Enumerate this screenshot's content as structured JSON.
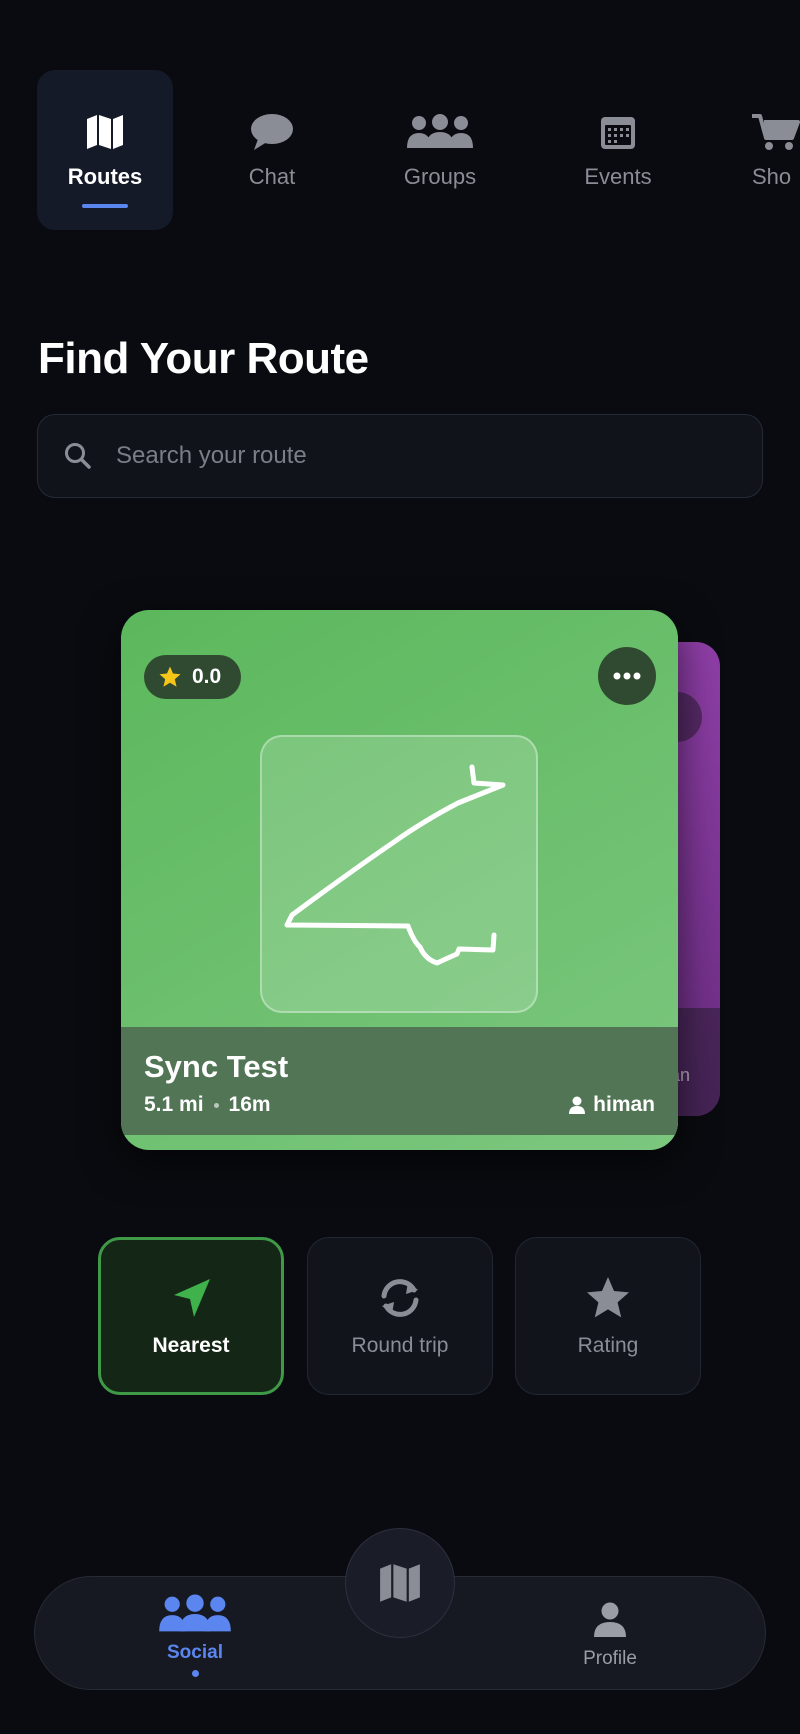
{
  "tabs": [
    {
      "label": "Routes",
      "icon": "map-icon",
      "active": true
    },
    {
      "label": "Chat",
      "icon": "chat-bubble-icon",
      "active": false
    },
    {
      "label": "Groups",
      "icon": "groups-icon",
      "active": false
    },
    {
      "label": "Events",
      "icon": "calendar-icon",
      "active": false
    },
    {
      "label": "Sho",
      "icon": "cart-icon",
      "active": false
    }
  ],
  "page": {
    "title": "Find Your Route"
  },
  "search": {
    "placeholder": "Search your route",
    "value": ""
  },
  "card": {
    "rating": "0.0",
    "name": "Sync Test",
    "distance": "5.1 mi",
    "duration": "16m",
    "author": "himan",
    "color": "#5cb85c"
  },
  "back_card": {
    "author_fragment": "an",
    "color": "#8e3ea6"
  },
  "filters": [
    {
      "label": "Nearest",
      "icon": "navigation-arrow-icon",
      "active": true
    },
    {
      "label": "Round trip",
      "icon": "round-trip-icon",
      "active": false
    },
    {
      "label": "Rating",
      "icon": "star-icon",
      "active": false
    }
  ],
  "bottom_nav": {
    "social": "Social",
    "profile": "Profile",
    "center_icon": "map-icon"
  },
  "colors": {
    "accent": "#5b86f0",
    "active_filter": "#3f9a48",
    "background": "#0a0b10"
  }
}
